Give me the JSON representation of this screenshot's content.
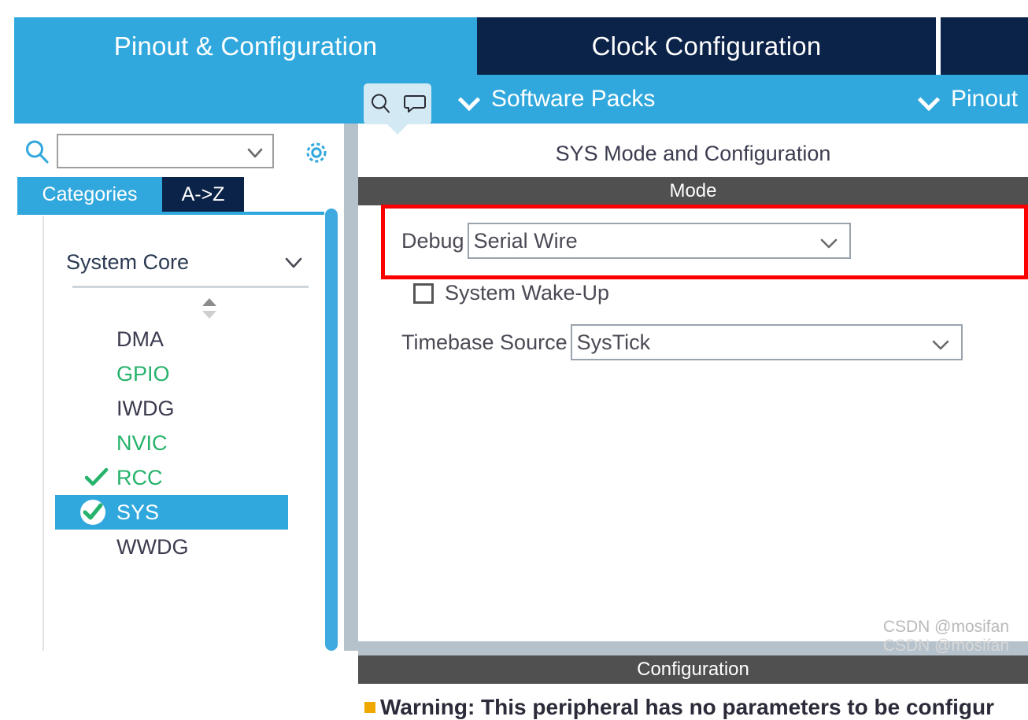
{
  "tabs": [
    {
      "label": "Pinout & Configuration",
      "active": true
    },
    {
      "label": "Clock Configuration",
      "active": false
    },
    {
      "label": "",
      "active": false
    }
  ],
  "toolbar": {
    "software_packs": "Software Packs",
    "pinout": "Pinout",
    "search_icon": "search-icon",
    "comment_icon": "comment-icon"
  },
  "sidebar": {
    "search": {
      "value": "",
      "placeholder": ""
    },
    "gear_icon": "gear-icon",
    "view_tabs": [
      {
        "label": "Categories",
        "active": true
      },
      {
        "label": "A->Z",
        "active": false
      }
    ],
    "group": {
      "label": "System Core",
      "expanded": true
    },
    "items": [
      {
        "label": "DMA",
        "state": "none",
        "color": "#3c3c50",
        "selected": false
      },
      {
        "label": "GPIO",
        "state": "none",
        "color": "#26b36b",
        "selected": false
      },
      {
        "label": "IWDG",
        "state": "none",
        "color": "#3c3c50",
        "selected": false
      },
      {
        "label": "NVIC",
        "state": "none",
        "color": "#26b36b",
        "selected": false
      },
      {
        "label": "RCC",
        "state": "check",
        "color": "#26b36b",
        "selected": false
      },
      {
        "label": "SYS",
        "state": "check-circle",
        "color": "#ffffff",
        "selected": true
      },
      {
        "label": "WWDG",
        "state": "none",
        "color": "#3c3c50",
        "selected": false
      }
    ]
  },
  "main": {
    "title": "SYS Mode and Configuration",
    "mode_header": "Mode",
    "configuration_header": "Configuration",
    "fields": {
      "debug": {
        "label": "Debug",
        "value": "Serial Wire",
        "highlighted": true
      },
      "system_wakeup": {
        "label": "System Wake-Up",
        "checked": false
      },
      "timebase": {
        "label": "Timebase Source",
        "value": "SysTick"
      }
    },
    "warning": "Warning: This peripheral has no parameters to be configur"
  },
  "watermark": {
    "line1": "CSDN @mosifan",
    "line2": "CSDN @mosifan"
  },
  "colors": {
    "accent_blue": "#31a8dd",
    "dark_navy": "#0b2349",
    "header_gray": "#505050",
    "highlight_red": "#fc0000",
    "green": "#26b36b",
    "splitter_gray": "#b6c2cb"
  }
}
